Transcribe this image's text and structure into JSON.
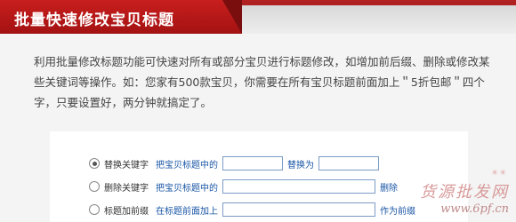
{
  "header": {
    "title": "批量快速修改宝贝标题"
  },
  "description": "利用批量修改标题功能可快速对所有或部分宝贝进行标题修改，如增加前后缀、删除或修改某些关键词等操作。如：您家有500款宝贝，你需要在所有宝贝标题前面加上＂5折包邮＂四个字，只要设置好，两分钟就搞定了。",
  "options": [
    {
      "label": "替换关键字",
      "checked": true,
      "prefix": "把宝贝标题中的",
      "input_value": "",
      "suffix": "替换为",
      "input2_value": ""
    },
    {
      "label": "删除关键字",
      "checked": false,
      "prefix": "把宝贝标题中的",
      "input_value": "",
      "suffix": "删除"
    },
    {
      "label": "标题加前缀",
      "checked": false,
      "prefix": "在标题前面加上",
      "input_value": "",
      "suffix": "作为前缀"
    }
  ],
  "watermark": {
    "text_cn": "货源批发网",
    "url": "www.6pf.cn",
    "dots": "✴✴"
  },
  "colors": {
    "header_red": "#b22222",
    "link_blue": "#1a56a6",
    "input_border": "#7a9cc6"
  }
}
